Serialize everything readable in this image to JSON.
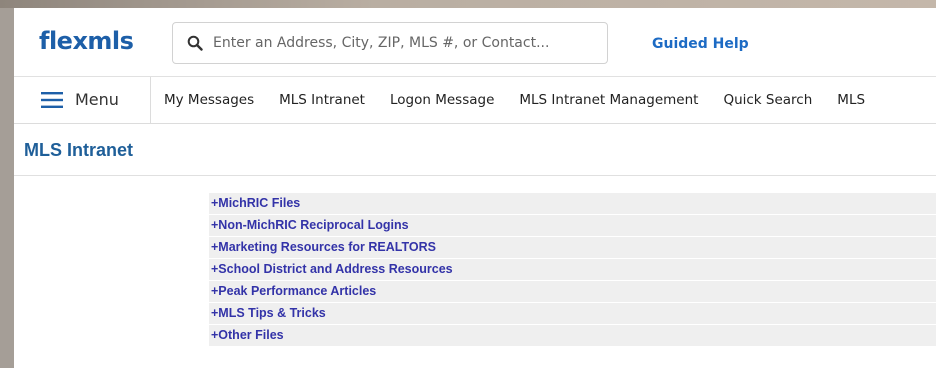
{
  "header": {
    "logo": "flexmls",
    "search_placeholder": "Enter an Address, City, ZIP, MLS #, or Contact...",
    "guided_help": "Guided Help"
  },
  "nav": {
    "menu_label": "Menu",
    "items": [
      "My Messages",
      "MLS Intranet",
      "Logon Message",
      "MLS Intranet Management",
      "Quick Search",
      "MLS"
    ]
  },
  "page": {
    "title": "MLS Intranet"
  },
  "sections": [
    "+MichRIC Files",
    "+Non-MichRIC Reciprocal Logins",
    "+Marketing Resources for REALTORS",
    "+School District and Address Resources",
    "+Peak Performance Articles",
    "+MLS Tips & Tricks",
    "+Other Files"
  ],
  "colors": {
    "brand": "#1d5fa8",
    "link": "#3333a8",
    "title": "#1f5f99"
  }
}
